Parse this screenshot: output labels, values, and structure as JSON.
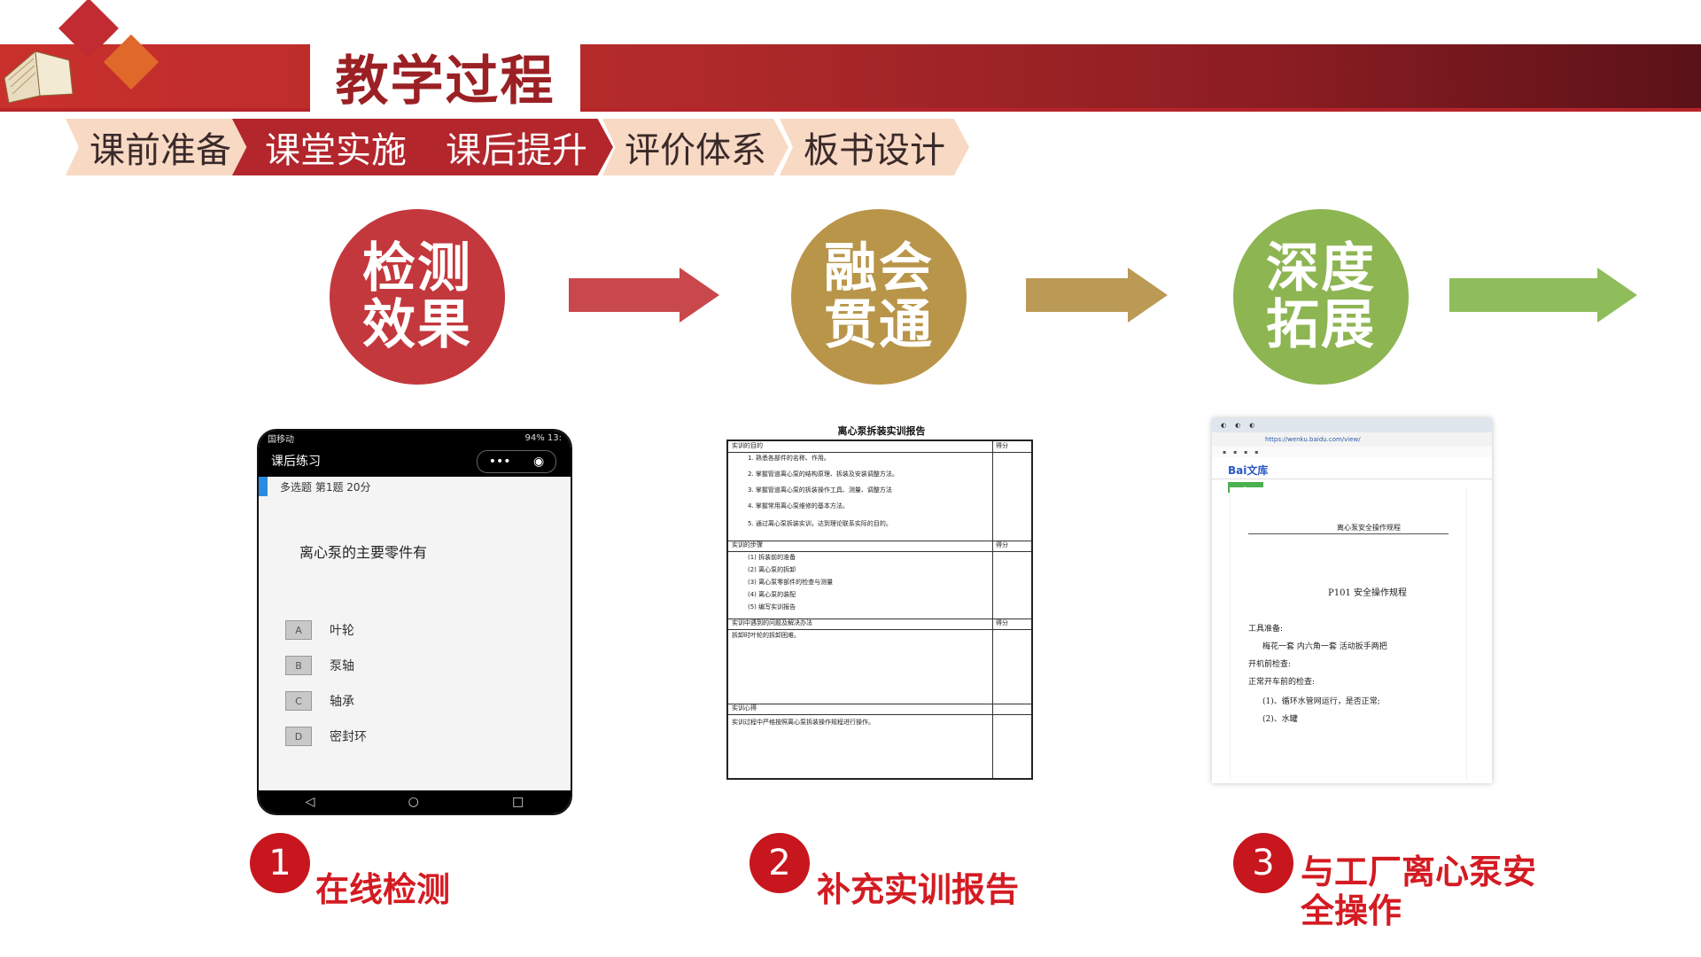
{
  "header": {
    "title": "教学过程"
  },
  "tabs": [
    {
      "label": "课前准备",
      "active": false
    },
    {
      "label": "课堂实施",
      "active": true
    },
    {
      "label": "课后提升",
      "active": true
    },
    {
      "label": "评价体系",
      "active": false
    },
    {
      "label": "板书设计",
      "active": false
    }
  ],
  "steps": [
    {
      "line1": "检测",
      "line2": "效果",
      "color": "#c3383d"
    },
    {
      "line1": "融会",
      "line2": "贯通",
      "color": "#b9954a"
    },
    {
      "line1": "深度",
      "line2": "拓展",
      "color": "#8db552"
    }
  ],
  "arrow_colors": [
    "#c9484b",
    "#bb9a55",
    "#8fbd5b"
  ],
  "phone": {
    "carrier": "国移动",
    "status_right": "94% 13:",
    "title": "课后练习",
    "meta": "多选题   第1题   20分",
    "question": "离心泵的主要零件有",
    "options": [
      {
        "letter": "A",
        "text": "叶轮"
      },
      {
        "letter": "B",
        "text": "泵轴"
      },
      {
        "letter": "C",
        "text": "轴承"
      },
      {
        "letter": "D",
        "text": "密封环"
      }
    ]
  },
  "report": {
    "title": "离心泵拆装实训报告",
    "sec1": "实训的目的",
    "score": "得分",
    "sec1_items": [
      "1. 熟悉各部件的名称、作用。",
      "2. 掌握管道离心泵的结构原理、拆装及安装调整方法。",
      "3. 掌握管道离心泵的拆装操作工具、测量、调整方法",
      "4. 掌握常用离心泵维修的基本方法。",
      "5. 通过离心泵拆装实训，达到理论联系实际的目的。"
    ],
    "sec2": "实训的步骤",
    "sec2_items": [
      "(1) 拆装前的准备",
      "(2) 离心泵的拆卸",
      "(3) 离心泵零部件的检查与测量",
      "(4) 离心泵的装配",
      "(5) 编写实训报告"
    ],
    "sec3": "实训中遇到的问题及解决办法",
    "sec3_text": "拆卸时叶轮的拆卸困难。",
    "sec4": "实训心得",
    "sec4_text": "实训过程中严格按照离心泵拆装操作规程进行操作。"
  },
  "browser": {
    "url": "https://wenku.baidu.com/view/",
    "logo": "Bai文库",
    "doc_header": "离心泵安全操作规程",
    "doc_title": "P101 安全操作规程",
    "tools_label": "工具准备:",
    "tools": "梅花一套    内六角一套    活动扳手两把",
    "check_label": "开机前检查:",
    "check_item": "正常开车前的检查:",
    "line1": "(1)、循环水管网运行，是否正常;",
    "line2": "(2)、水罐"
  },
  "labels": [
    {
      "num": "1",
      "text": "在线检测"
    },
    {
      "num": "2",
      "text": "补充实训报告"
    },
    {
      "num": "3",
      "text": "与工厂离心泵安全操作"
    }
  ]
}
